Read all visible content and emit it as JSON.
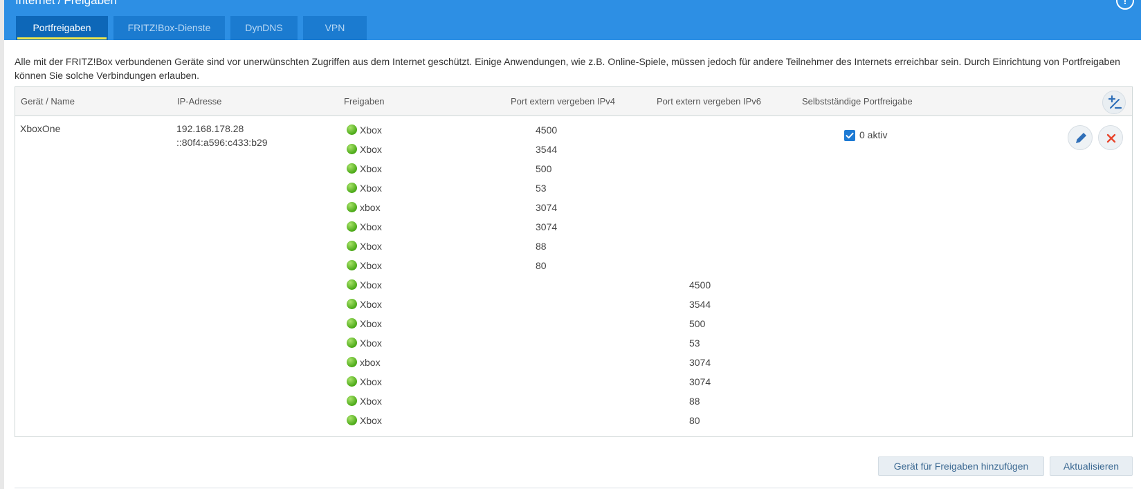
{
  "breadcrumb": {
    "section": "Internet",
    "separator": "/",
    "page": "Freigaben"
  },
  "tabs": [
    {
      "label": "Portfreigaben",
      "active": true
    },
    {
      "label": "FRITZ!Box-Dienste",
      "active": false
    },
    {
      "label": "DynDNS",
      "active": false
    },
    {
      "label": "VPN",
      "active": false
    }
  ],
  "intro_text": "Alle mit der FRITZ!Box verbundenen Geräte sind vor unerwünschten Zugriffen aus dem Internet geschützt. Einige Anwendungen, wie z.B. Online-Spiele, müssen jedoch für andere Teilnehmer des Internets erreichbar sein. Durch Einrichtung von Portfreigaben können Sie solche Verbindungen erlauben.",
  "table": {
    "columns": [
      "Gerät / Name",
      "IP-Adresse",
      "Freigaben",
      "Port extern vergeben IPv4",
      "Port extern vergeben IPv6",
      "Selbstständige Portfreigabe"
    ],
    "device": {
      "name": "XboxOne",
      "ipv4": "192.168.178.28",
      "ipv6": "::80f4:a596:c433:b29",
      "self_share_label": "0 aktiv",
      "self_share_checked": true,
      "shares": [
        {
          "name": "Xbox",
          "ipv4": "4500",
          "ipv6": ""
        },
        {
          "name": "Xbox",
          "ipv4": "3544",
          "ipv6": ""
        },
        {
          "name": "Xbox",
          "ipv4": "500",
          "ipv6": ""
        },
        {
          "name": "Xbox",
          "ipv4": "53",
          "ipv6": ""
        },
        {
          "name": "xbox",
          "ipv4": "3074",
          "ipv6": ""
        },
        {
          "name": "Xbox",
          "ipv4": "3074",
          "ipv6": ""
        },
        {
          "name": "Xbox",
          "ipv4": "88",
          "ipv6": ""
        },
        {
          "name": "Xbox",
          "ipv4": "80",
          "ipv6": ""
        },
        {
          "name": "Xbox",
          "ipv4": "",
          "ipv6": "4500"
        },
        {
          "name": "Xbox",
          "ipv4": "",
          "ipv6": "3544"
        },
        {
          "name": "Xbox",
          "ipv4": "",
          "ipv6": "500"
        },
        {
          "name": "Xbox",
          "ipv4": "",
          "ipv6": "53"
        },
        {
          "name": "xbox",
          "ipv4": "",
          "ipv6": "3074"
        },
        {
          "name": "Xbox",
          "ipv4": "",
          "ipv6": "3074"
        },
        {
          "name": "Xbox",
          "ipv4": "",
          "ipv6": "88"
        },
        {
          "name": "Xbox",
          "ipv4": "",
          "ipv6": "80"
        }
      ]
    }
  },
  "buttons": {
    "add_device": "Gerät für Freigaben hinzufügen",
    "refresh": "Aktualisieren"
  },
  "colors": {
    "header": "#2d8fe4",
    "tab_active": "#0d67b8",
    "tab_underline": "#f0e84a",
    "status_dot": "#4caa18",
    "delete": "#e8452c",
    "edit": "#2f6fb8"
  }
}
